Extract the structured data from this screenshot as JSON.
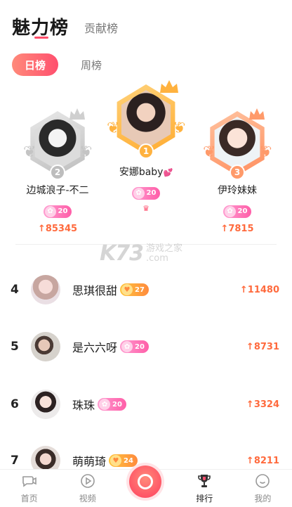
{
  "header": {
    "active_tab": "魅力榜",
    "other_tab": "贡献榜"
  },
  "period": {
    "active": "日榜",
    "other": "周榜"
  },
  "podium": [
    {
      "rank": "2",
      "name": "边城浪子-不二",
      "level": "20",
      "score": "↑85345"
    },
    {
      "rank": "1",
      "name": "安娜baby",
      "level": "20",
      "score": ""
    },
    {
      "rank": "3",
      "name": "伊玲妹妹",
      "level": "20",
      "score": "↑7815"
    }
  ],
  "watermark": {
    "logo": "K73",
    "site": "游戏之家",
    "domain": ".com"
  },
  "list": [
    {
      "rank": "4",
      "name": "思琪很甜",
      "level": "27",
      "badge": "gold",
      "score": "↑11480"
    },
    {
      "rank": "5",
      "name": "是六六呀",
      "level": "20",
      "badge": "pink",
      "score": "↑8731"
    },
    {
      "rank": "6",
      "name": "珠珠",
      "level": "20",
      "badge": "pink",
      "score": "↑3324"
    },
    {
      "rank": "7",
      "name": "萌萌琦",
      "level": "24",
      "badge": "gold",
      "score": "↑8211"
    }
  ],
  "nav": [
    {
      "label": "首页",
      "icon": "chat-bubble-icon"
    },
    {
      "label": "视频",
      "icon": "play-circle-icon"
    },
    {
      "label": "排行",
      "icon": "trophy-icon"
    },
    {
      "label": "我的",
      "icon": "smile-face-icon"
    }
  ],
  "colors": {
    "accent": "#ff4f6e",
    "score": "#ff6a3d",
    "gold": "#ffb23f",
    "silver": "#c9c9c9",
    "bronze": "#ff9a6a"
  }
}
